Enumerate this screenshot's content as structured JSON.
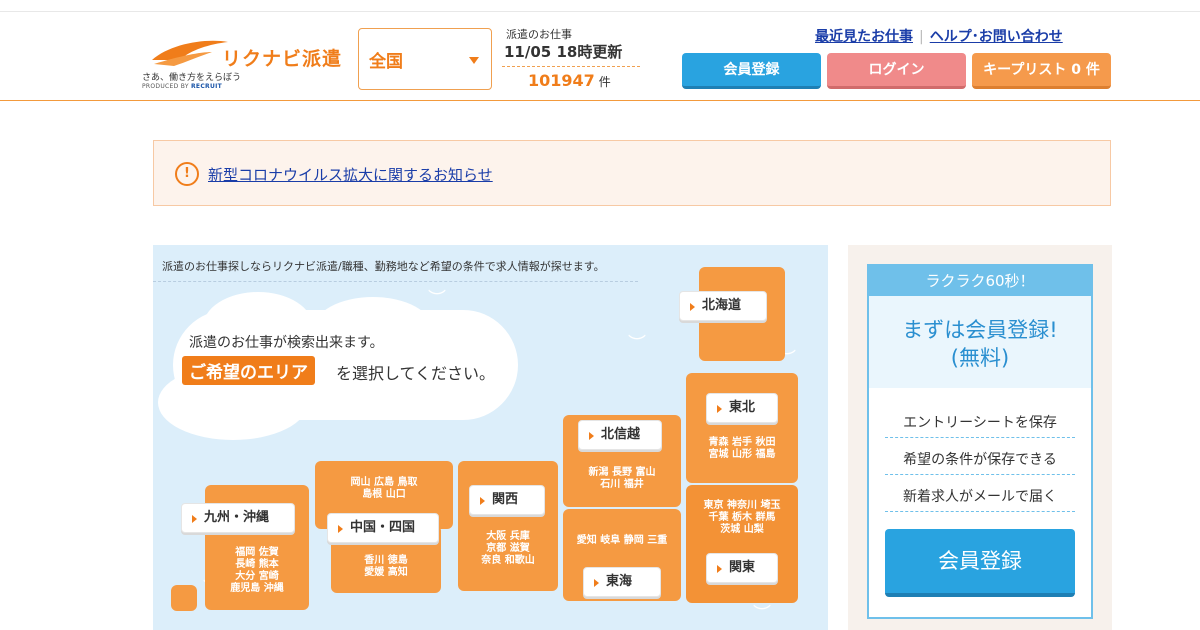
{
  "header": {
    "brand": "リクナビ派遣",
    "tagline": "さあ、働き方をえらぼう",
    "produced_by": "PRODUCED BY",
    "recruit": "RECRUIT",
    "area": "全国",
    "jobs_label": "派遣のお仕事",
    "updated": "11/05 18時更新",
    "count": "101947",
    "count_unit": "件",
    "links": [
      "最近見たお仕事",
      "ヘルプ･お問い合わせ"
    ],
    "register": "会員登録",
    "login": "ログイン",
    "keeplist": "キープリスト 0 件"
  },
  "notice": {
    "icon": "!",
    "text": "新型コロナウイルス拡大に関するお知らせ"
  },
  "map": {
    "description": "派遣のお仕事探しならリクナビ派遣/職種、勤務地など希望の条件で求人情報が探せます。",
    "cloud_line1": "派遣のお仕事が検索出来ます。",
    "cloud_tag": "ご希望のエリア",
    "cloud_line2": "を選択してください。",
    "regions": {
      "hokkaido": {
        "name": "北海道"
      },
      "tohoku": {
        "name": "東北",
        "prefs": [
          "青森 岩手 秋田",
          "宮城 山形 福島"
        ]
      },
      "kanto": {
        "name": "関東",
        "prefs": [
          "東京 神奈川 埼玉",
          "千葉 栃木 群馬",
          "茨城 山梨"
        ]
      },
      "hokushinetsu": {
        "name": "北信越",
        "prefs": [
          "新潟 長野 富山",
          "石川 福井"
        ]
      },
      "tokai": {
        "name": "東海",
        "prefs": [
          "愛知 岐阜 静岡 三重"
        ]
      },
      "kansai": {
        "name": "関西",
        "prefs": [
          "大阪 兵庫",
          "京都 滋賀",
          "奈良 和歌山"
        ]
      },
      "chugoku": {
        "name": "中国・四国",
        "prefs_top": [
          "岡山 広島 鳥取",
          "島根 山口"
        ],
        "prefs_bottom": [
          "香川 徳島",
          "愛媛 高知"
        ]
      },
      "kyushu": {
        "name": "九州・沖縄",
        "prefs": [
          "福岡 佐賀",
          "長崎 熊本",
          "大分 宮崎",
          "鹿児島 沖縄"
        ]
      }
    }
  },
  "side": {
    "head": "ラクラク60秒！",
    "title_line1": "まずは会員登録!",
    "title_line2": "(無料)",
    "items": [
      "エントリーシートを保存",
      "希望の条件が保存できる",
      "新着求人がメールで届く"
    ],
    "button": "会員登録"
  },
  "colors": {
    "accent": "#f07d1a",
    "blue": "#29a3e0",
    "pink": "#f08a8a"
  }
}
